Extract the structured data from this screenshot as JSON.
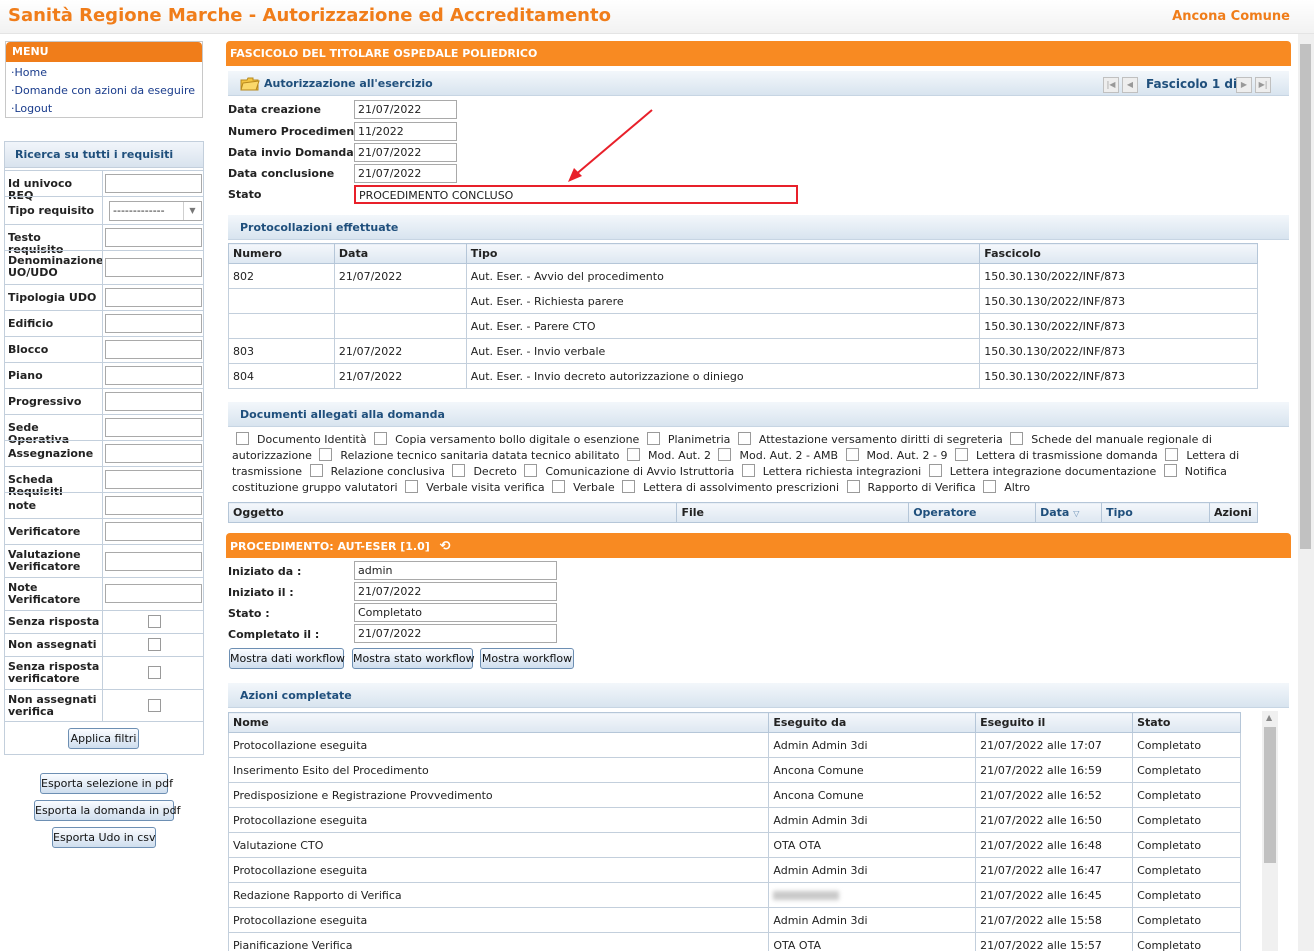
{
  "header": {
    "title": "Sanità Regione Marche - Autorizzazione ed Accreditamento",
    "user": "Ancona Comune"
  },
  "menu": {
    "title": "MENU",
    "items": [
      "·Home",
      "·Domande con azioni da eseguire",
      "·Logout"
    ]
  },
  "search": {
    "title": "Ricerca su tutti i requisiti",
    "fields": {
      "id_req": "Id univoco REQ",
      "tipo": "Tipo requisito",
      "tipo_value": "-------------",
      "testo": "Testo requisito",
      "denominazione": "Denominazione UO/UDO",
      "tipologia": "Tipologia UDO",
      "edificio": "Edificio",
      "blocco": "Blocco",
      "piano": "Piano",
      "progressivo": "Progressivo",
      "sede": "Sede Operativa",
      "assegnazione": "Assegnazione",
      "scheda": "Scheda Requisiti",
      "note": "note",
      "verificatore": "Verificatore",
      "valutazione": "Valutazione Verificatore",
      "note_verificatore": "Note Verificatore",
      "senza_risposta": "Senza risposta",
      "non_assegnati": "Non assegnati",
      "senza_risposta_ver": "Senza risposta verificatore",
      "non_assegnati_ver": "Non assegnati verifica"
    },
    "apply": "Applica filtri"
  },
  "exports": {
    "pdf_selection": "Esporta selezione in pdf",
    "pdf_domanda": "Esporta la domanda in pdf",
    "csv_udo": "Esporta Udo in csv"
  },
  "fascicolo": {
    "title": "FASCICOLO DEL TITOLARE OSPEDALE POLIEDRICO",
    "section": "Autorizzazione all'esercizio",
    "pager": "Fascicolo 1 di 1",
    "fields": {
      "data_creazione": {
        "label": "Data creazione",
        "value": "21/07/2022"
      },
      "numero": {
        "label": "Numero Procedimento",
        "value": "11/2022"
      },
      "data_invio": {
        "label": "Data invio Domanda",
        "value": "21/07/2022"
      },
      "data_conclusione": {
        "label": "Data conclusione",
        "value": "21/07/2022"
      },
      "stato": {
        "label": "Stato",
        "value": "PROCEDIMENTO CONCLUSO"
      }
    }
  },
  "protocollazioni": {
    "title": "Protocollazioni effettuate",
    "columns": [
      "Numero",
      "Data",
      "Tipo",
      "Fascicolo"
    ],
    "rows": [
      [
        "802",
        "21/07/2022",
        "Aut. Eser. - Avvio del procedimento",
        "150.30.130/2022/INF/873"
      ],
      [
        "",
        "",
        "Aut. Eser. - Richiesta parere",
        "150.30.130/2022/INF/873"
      ],
      [
        "",
        "",
        "Aut. Eser. - Parere CTO",
        "150.30.130/2022/INF/873"
      ],
      [
        "803",
        "21/07/2022",
        "Aut. Eser. - Invio verbale",
        "150.30.130/2022/INF/873"
      ],
      [
        "804",
        "21/07/2022",
        "Aut. Eser. - Invio decreto autorizzazione o diniego",
        "150.30.130/2022/INF/873"
      ]
    ]
  },
  "documenti": {
    "title": "Documenti allegati alla domanda",
    "items": [
      "Documento Identità",
      "Copia versamento bollo digitale o esenzione",
      "Planimetria",
      "Attestazione versamento diritti di segreteria",
      "Schede del manuale regionale di autorizzazione",
      "Relazione tecnico sanitaria datata tecnico abilitato",
      "Mod. Aut. 2",
      "Mod. Aut. 2 - AMB",
      "Mod. Aut. 2 - 9",
      "Lettera di trasmissione domanda",
      "Lettera di trasmissione",
      "Relazione conclusiva",
      "Decreto",
      "Comunicazione di Avvio Istruttoria",
      "Lettera richiesta integrazioni",
      "Lettera integrazione documentazione",
      "Notifica costituzione gruppo valutatori",
      "Verbale visita verifica",
      "Verbale",
      "Lettera di assolvimento prescrizioni",
      "Rapporto di Verifica",
      "Altro"
    ],
    "columns": [
      "Oggetto",
      "File",
      "Operatore",
      "Data",
      "Tipo",
      "Azioni"
    ]
  },
  "procedimento": {
    "title": "PROCEDIMENTO: AUT-ESER [1.0]",
    "fields": {
      "iniziato_da": {
        "label": "Iniziato da :",
        "value": "admin"
      },
      "iniziato_il": {
        "label": "Iniziato il :",
        "value": "21/07/2022"
      },
      "stato": {
        "label": "Stato :",
        "value": "Completato"
      },
      "completato_il": {
        "label": "Completato il :",
        "value": "21/07/2022"
      }
    },
    "buttons": [
      "Mostra dati workflow",
      "Mostra stato workflow",
      "Mostra workflow"
    ]
  },
  "azioni": {
    "title": "Azioni completate",
    "columns": [
      "Nome",
      "Eseguito da",
      "Eseguito il",
      "Stato"
    ],
    "rows": [
      [
        "Protocollazione eseguita",
        "Admin Admin 3di",
        "21/07/2022 alle 17:07",
        "Completato"
      ],
      [
        "Inserimento Esito del Procedimento",
        "Ancona Comune",
        "21/07/2022 alle 16:59",
        "Completato"
      ],
      [
        "Predisposizione e Registrazione Provvedimento",
        "Ancona Comune",
        "21/07/2022 alle 16:52",
        "Completato"
      ],
      [
        "Protocollazione eseguita",
        "Admin Admin 3di",
        "21/07/2022 alle 16:50",
        "Completato"
      ],
      [
        "Valutazione CTO",
        "OTA OTA",
        "21/07/2022 alle 16:48",
        "Completato"
      ],
      [
        "Protocollazione eseguita",
        "Admin Admin 3di",
        "21/07/2022 alle 16:47",
        "Completato"
      ],
      [
        "Redazione Rapporto di Verifica",
        "",
        "21/07/2022 alle 16:45",
        "Completato"
      ],
      [
        "Protocollazione eseguita",
        "Admin Admin 3di",
        "21/07/2022 alle 15:58",
        "Completato"
      ],
      [
        "Pianificazione Verifica",
        "OTA OTA",
        "21/07/2022 alle 15:57",
        "Completato"
      ]
    ]
  },
  "colors": {
    "accent": "#f88a22",
    "title": "#f07d1a",
    "link": "#1a3c8c",
    "highlight": "#e8202a"
  }
}
